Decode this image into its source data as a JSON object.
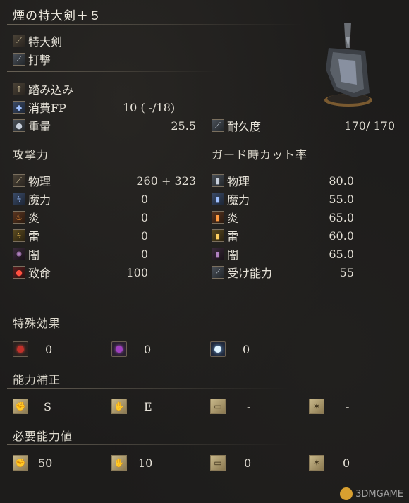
{
  "title": "煙の特大剣＋５",
  "weapon": {
    "type": "特大剣",
    "attack_type": "打撃",
    "skill": "踏み込み",
    "fp_label": "消費FP",
    "fp_value": "10 (  -/18)",
    "weight_label": "重量",
    "weight_value": "25.5",
    "durability_label": "耐久度",
    "durability_value": "170/ 170"
  },
  "attack": {
    "heading": "攻撃力",
    "rows": [
      {
        "label": "物理",
        "value": "260 +  323",
        "icon": "sword-icon"
      },
      {
        "label": "魔力",
        "value": "0",
        "icon": "magic-icon"
      },
      {
        "label": "炎",
        "value": "0",
        "icon": "fire-icon"
      },
      {
        "label": "雷",
        "value": "0",
        "icon": "lightning-icon"
      },
      {
        "label": "闇",
        "value": "0",
        "icon": "dark-icon"
      },
      {
        "label": "致命",
        "value": "100",
        "icon": "critical-icon"
      }
    ]
  },
  "guard": {
    "heading": "ガード時カット率",
    "rows": [
      {
        "label": "物理",
        "value": "80.0",
        "icon": "shield-physical-icon"
      },
      {
        "label": "魔力",
        "value": "55.0",
        "icon": "shield-magic-icon"
      },
      {
        "label": "炎",
        "value": "65.0",
        "icon": "shield-fire-icon"
      },
      {
        "label": "雷",
        "value": "60.0",
        "icon": "shield-lightning-icon"
      },
      {
        "label": "闇",
        "value": "65.0",
        "icon": "shield-dark-icon"
      },
      {
        "label": "受け能力",
        "value": "55",
        "icon": "stability-icon"
      }
    ]
  },
  "special": {
    "heading": "特殊効果",
    "items": [
      {
        "icon": "bleed-icon",
        "value": "0",
        "color": "#c0302a"
      },
      {
        "icon": "poison-icon",
        "value": "0",
        "color": "#a040c0"
      },
      {
        "icon": "frost-icon",
        "value": "0",
        "color": "#a0d8ff"
      }
    ]
  },
  "scaling": {
    "heading": "能力補正",
    "items": [
      {
        "icon": "strength-icon",
        "value": "S"
      },
      {
        "icon": "dexterity-icon",
        "value": "E"
      },
      {
        "icon": "intelligence-icon",
        "value": "-"
      },
      {
        "icon": "faith-icon",
        "value": "-"
      }
    ]
  },
  "requirements": {
    "heading": "必要能力値",
    "items": [
      {
        "icon": "strength-icon",
        "value": "50"
      },
      {
        "icon": "dexterity-icon",
        "value": "10"
      },
      {
        "icon": "intelligence-icon",
        "value": "0"
      },
      {
        "icon": "faith-icon",
        "value": "0"
      }
    ]
  },
  "watermark": "3DMGAME"
}
